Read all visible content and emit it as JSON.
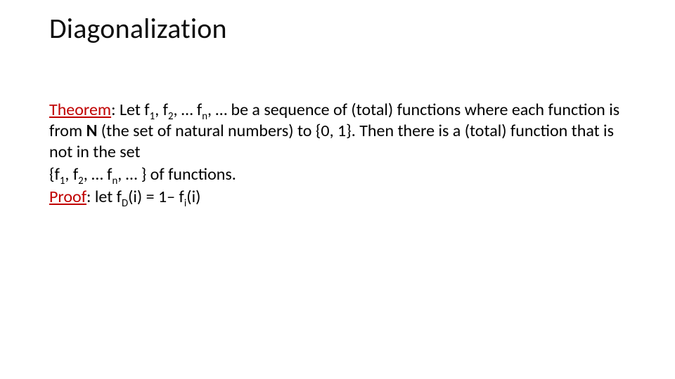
{
  "slide": {
    "title": "Diagonalization",
    "theorem": {
      "label": "Theorem",
      "colon": ": ",
      "pre_seq": "Let f",
      "s1": "1",
      "c1": ", f",
      "s2": "2",
      "c2": ", … f",
      "sn": "n",
      "after_seq": ", … be a sequence of (total) functions where each function is from ",
      "natset": "N",
      "rest": " (the set of natural numbers) to {0, 1}. Then there is a (total) function that is not in the set"
    },
    "setline": {
      "open": "{f",
      "s1": "1",
      "c1": ", f",
      "s2": "2",
      "c2": ", … f",
      "sn": "n",
      "tail": ", … } of functions."
    },
    "proof": {
      "label": "Proof",
      "colon": ": ",
      "pre": "let f",
      "sD": "D",
      "mid": "(i) = 1– f",
      "si": "i",
      "tail": "(i)"
    }
  }
}
